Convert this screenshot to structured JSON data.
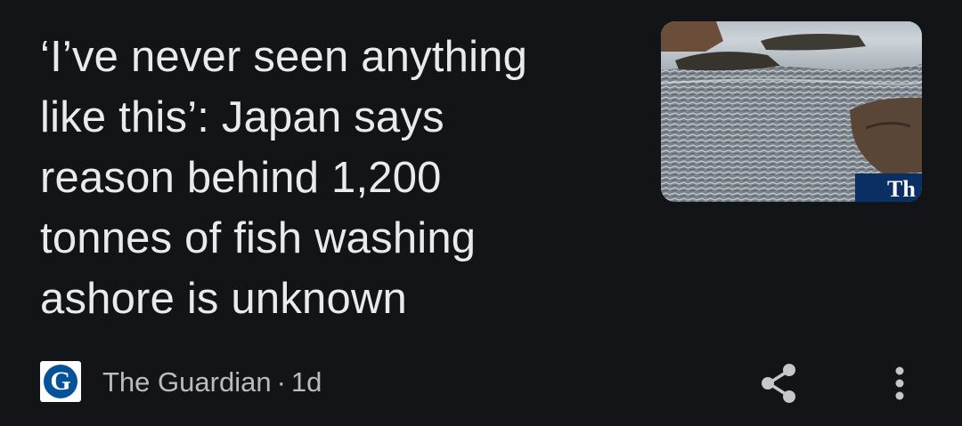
{
  "article": {
    "headline_lines": [
      "‘I’ve never seen anything",
      "like this’: Japan says",
      "reason behind 1,200",
      "tonnes of fish washing",
      "ashore is unknown"
    ],
    "thumbnail_overlay_text": "Th",
    "thumbnail_icon": "beach-with-dead-fish-photo"
  },
  "source": {
    "logo_letter": "G",
    "name": "The Guardian",
    "separator": "·",
    "age": "1d"
  },
  "actions": {
    "share_icon": "share-icon",
    "more_icon": "more-vertical-icon"
  },
  "colors": {
    "background": "#121418",
    "headline_text": "#e9eaec",
    "meta_text": "#b9bcc1",
    "guardian_blue": "#05529b"
  }
}
